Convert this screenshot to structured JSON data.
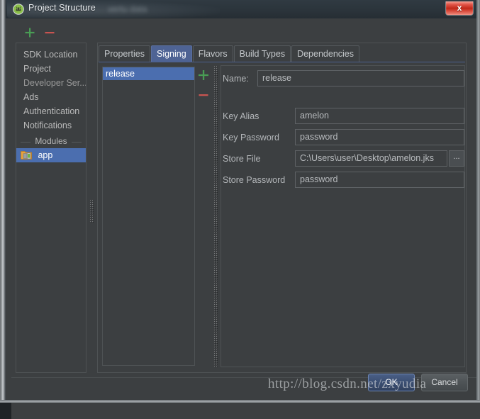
{
  "window": {
    "title": "Project Structure",
    "blurred_title_suffix": "vertu data",
    "close_label": "x",
    "close_icon": "close-icon"
  },
  "sidebar": {
    "toolbar": {
      "add_icon": "plus-icon",
      "remove_icon": "minus-icon"
    },
    "items": [
      {
        "label": "SDK Location",
        "selected": false,
        "type": "item"
      },
      {
        "label": "Project",
        "selected": false,
        "type": "item"
      },
      {
        "label": "Developer Ser...",
        "selected": false,
        "type": "item"
      },
      {
        "label": "Ads",
        "selected": false,
        "type": "item"
      },
      {
        "label": "Authentication",
        "selected": false,
        "type": "item"
      },
      {
        "label": "Notifications",
        "selected": false,
        "type": "item"
      }
    ],
    "group_label": "Modules",
    "modules": [
      {
        "label": "app",
        "selected": true,
        "icon": "android-module-icon"
      }
    ]
  },
  "tabs": [
    {
      "label": "Properties",
      "active": false
    },
    {
      "label": "Signing",
      "active": true
    },
    {
      "label": "Flavors",
      "active": false
    },
    {
      "label": "Build Types",
      "active": false
    },
    {
      "label": "Dependencies",
      "active": false
    }
  ],
  "signing": {
    "list": {
      "items": [
        {
          "label": "release",
          "selected": true
        }
      ],
      "add_icon": "plus-icon",
      "remove_icon": "minus-icon"
    },
    "fields": {
      "name_label": "Name:",
      "name_value": "release",
      "key_alias_label": "Key Alias",
      "key_alias_value": "amelon",
      "key_password_label": "Key Password",
      "key_password_value": "password",
      "store_file_label": "Store File",
      "store_file_value": "C:\\Users\\user\\Desktop\\amelon.jks",
      "browse_label": "...",
      "store_password_label": "Store Password",
      "store_password_value": "password"
    }
  },
  "buttons": {
    "ok": "OK",
    "cancel": "Cancel"
  },
  "watermark": "http://blog.csdn.net/zxyudia",
  "colors": {
    "selection_blue": "#4b6eaf",
    "active_tab_blue": "#4e6394",
    "panel_bg": "#3c3f41",
    "add_green": "#499c54",
    "remove_red": "#c75450",
    "close_red": "#c02819"
  }
}
